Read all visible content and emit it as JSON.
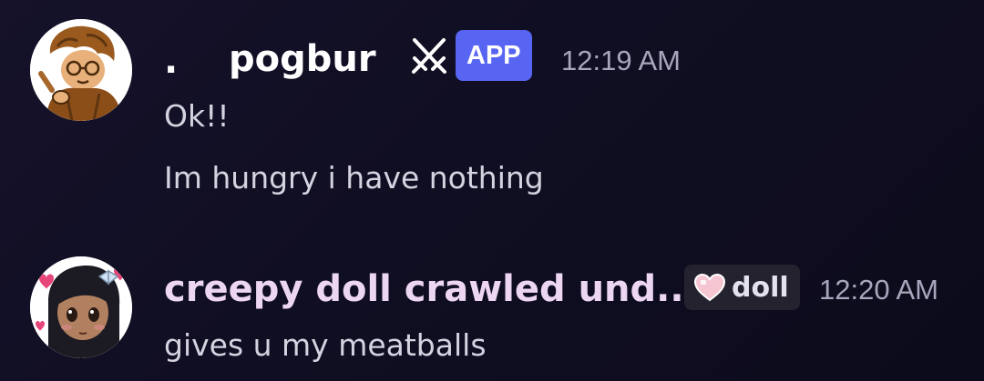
{
  "messages": [
    {
      "author": {
        "prefix": ".",
        "name": "pogbur",
        "name_color": "#ffffff",
        "avatar_icon": "character-avatar-icon",
        "badge_icon": "crossed-swords-icon",
        "badge_label": "APP",
        "badge_color": "#5865f2"
      },
      "timestamp": "12:19 AM",
      "lines": [
        "Ok!!",
        "Im hungry i have nothing"
      ]
    },
    {
      "author": {
        "name": "creepy doll crawled und...",
        "name_color": "#ecd6f2",
        "avatar_icon": "doll-avatar-icon",
        "tag_icon": "pink-heart-icon",
        "tag_label": "doll"
      },
      "timestamp": "12:20 AM",
      "lines": [
        "gives u my meatballs"
      ]
    }
  ]
}
